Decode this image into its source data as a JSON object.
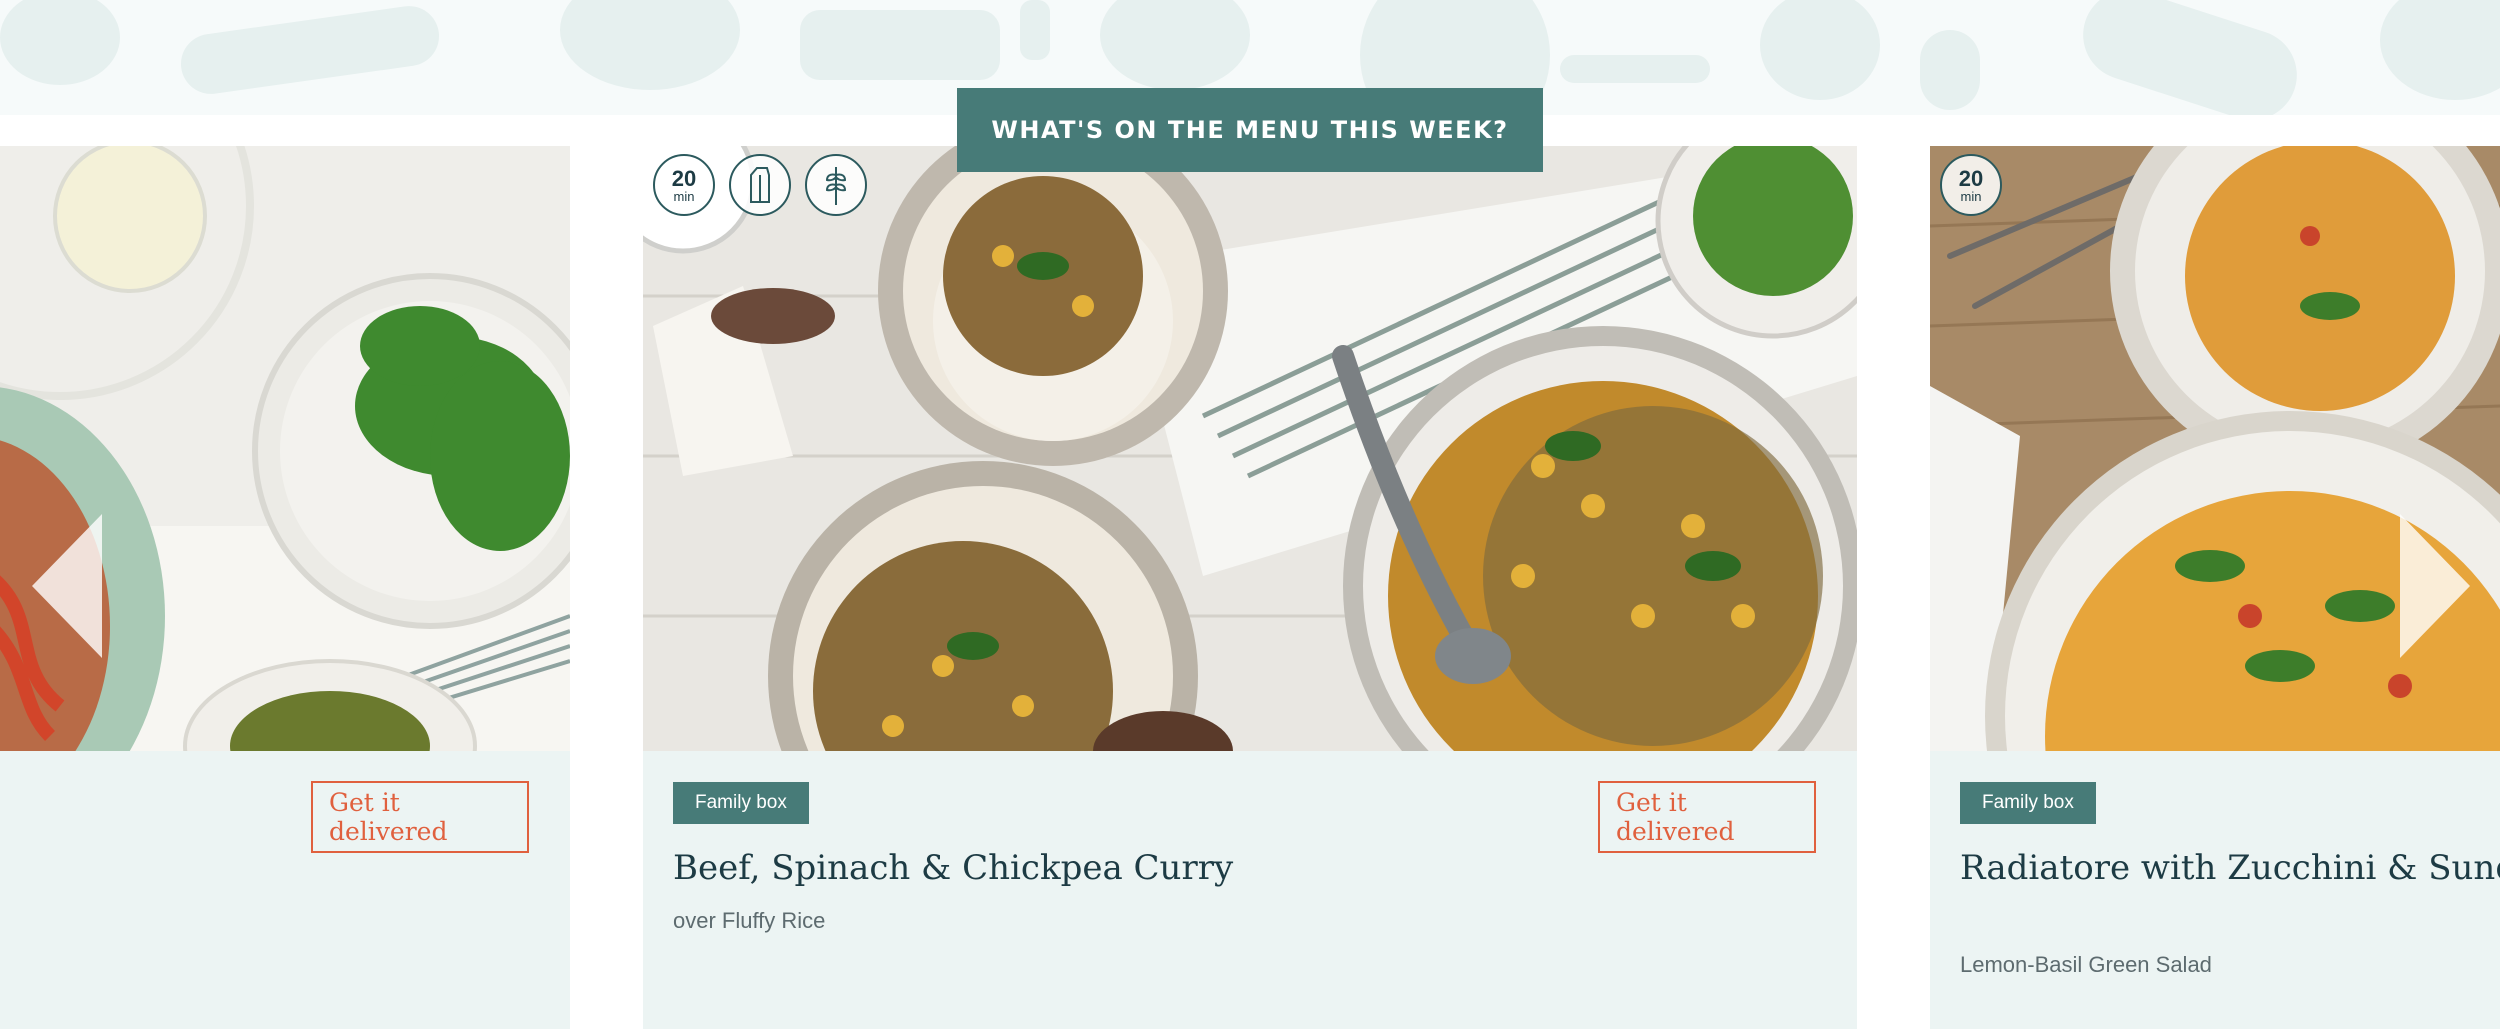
{
  "section": {
    "title": "WHAT'S ON THE MENU THIS WEEK?"
  },
  "cards": [
    {
      "position": "previous",
      "cta": "Get it delivered"
    },
    {
      "position": "current",
      "badges": {
        "time": "20",
        "time_unit": "min",
        "icons": [
          "dairy-free-icon",
          "wheat-free-icon"
        ]
      },
      "tag": "Family box",
      "title": "Beef, Spinach & Chickpea Curry",
      "subtitle": "over Fluffy Rice",
      "cta": "Get it delivered"
    },
    {
      "position": "next",
      "badges": {
        "time": "20",
        "time_unit": "min"
      },
      "tag": "Family box",
      "title": "Radiatore with Zucchini & Sundried Tomato Pesto",
      "subtitle": "Lemon-Basil Green Salad"
    }
  ],
  "colors": {
    "accent": "#477b78",
    "cta": "#e0603e",
    "card_bg": "#ecf4f3",
    "title": "#1d3b44"
  }
}
